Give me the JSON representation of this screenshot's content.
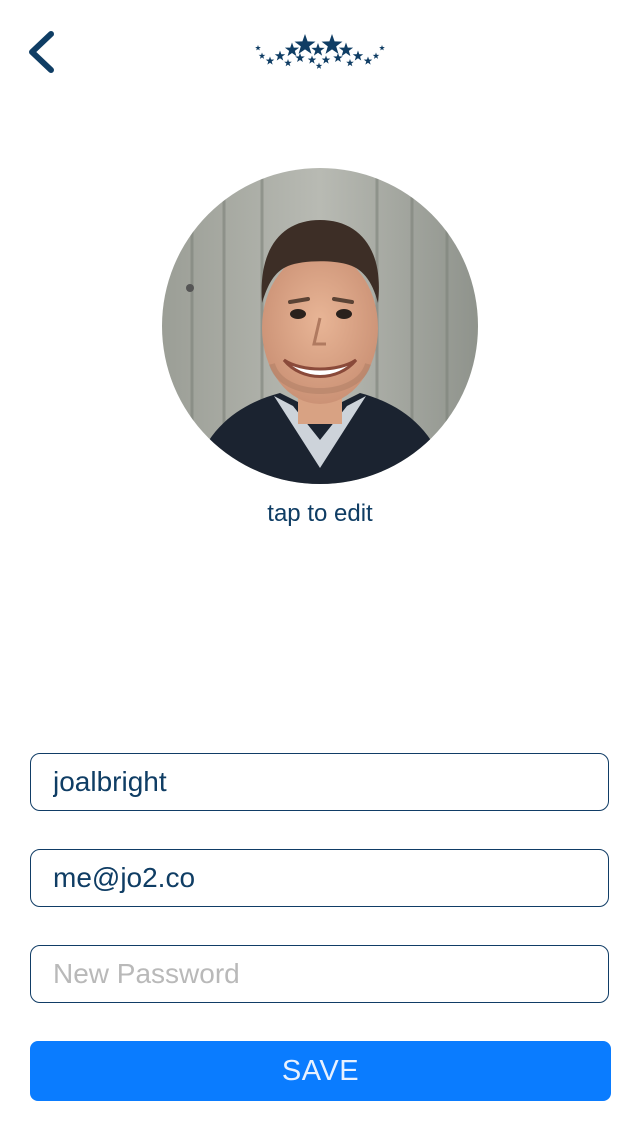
{
  "header": {
    "back_icon": "chevron-left-icon",
    "logo_icon": "stars-logo-icon",
    "accent_color": "#0f3d64"
  },
  "profile": {
    "avatar_icon": "avatar-photo",
    "edit_label": "tap to edit"
  },
  "form": {
    "username_value": "joalbright",
    "email_value": "me@jo2.co",
    "password_placeholder": "New Password",
    "password_value": "",
    "save_label": "SAVE",
    "save_color": "#0a7cff"
  }
}
